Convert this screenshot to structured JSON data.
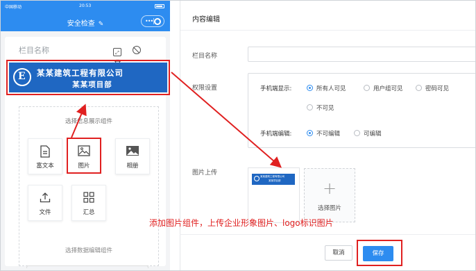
{
  "status_bar": {
    "carrier": "中国移动",
    "time": "20:53"
  },
  "nav": {
    "title": "安全检查",
    "edit_icon": "pencil-icon",
    "menu_icon": "more-dots-icon",
    "close_icon": "circle-close-icon"
  },
  "column": {
    "name_placeholder": "栏目名称",
    "tools": [
      "expand-icon",
      "ban-icon",
      "trash-icon"
    ]
  },
  "banner": {
    "company": "某某建筑工程有限公司",
    "project": "某某项目部"
  },
  "picker": {
    "title": "选择信息展示组件",
    "items": [
      {
        "label": "富文本",
        "icon": "document-icon"
      },
      {
        "label": "图片",
        "icon": "image-icon",
        "selected": true
      },
      {
        "label": "相册",
        "icon": "gallery-icon"
      },
      {
        "label": "文件",
        "icon": "upload-icon"
      },
      {
        "label": "汇总",
        "icon": "grid-icon"
      }
    ],
    "title2": "选择数据编辑组件"
  },
  "panel": {
    "title": "内容编辑",
    "name_label": "栏目名称",
    "perm_label": "权限设置",
    "mobile_display_label": "手机端显示:",
    "display_options": [
      "所有人可见",
      "用户组可见",
      "密码可见",
      "不可见"
    ],
    "display_selected": "所有人可见",
    "mobile_edit_label": "手机端编辑:",
    "edit_options": [
      "不可编辑",
      "可编辑"
    ],
    "edit_selected": "不可编辑",
    "upload_label": "图片上传",
    "thumb_text": {
      "company": "某某建筑工程有限公司",
      "project": "某某项目部"
    },
    "select_image": "选择图片",
    "cancel": "取消",
    "save": "保存"
  },
  "annotation": "添加图片组件，上传企业形象图片、logo标识图片",
  "colors": {
    "primary": "#2d8cf0",
    "banner": "#1f67c2",
    "highlight": "#e02020"
  }
}
